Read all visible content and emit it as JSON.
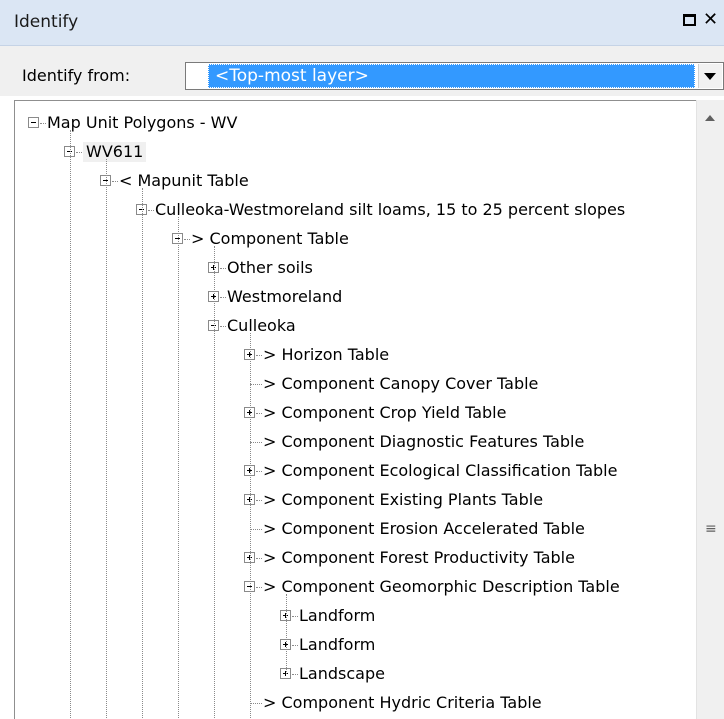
{
  "window": {
    "title": "Identify"
  },
  "identify_from": {
    "label": "Identify from:",
    "selected": "<Top-most layer>"
  },
  "tree": [
    {
      "label": "Map Unit Polygons - WV",
      "toggle": "minus",
      "level": 0
    },
    {
      "label": "WV611",
      "toggle": "minus",
      "level": 1,
      "highlight": true
    },
    {
      "label": "< Mapunit Table",
      "toggle": "minus",
      "level": 2
    },
    {
      "label": "Culleoka-Westmoreland silt loams, 15 to 25 percent slopes",
      "toggle": "minus",
      "level": 3
    },
    {
      "label": "> Component Table",
      "toggle": "minus",
      "level": 4
    },
    {
      "label": "Other soils",
      "toggle": "plus",
      "level": 5
    },
    {
      "label": "Westmoreland",
      "toggle": "plus",
      "level": 5
    },
    {
      "label": "Culleoka",
      "toggle": "minus",
      "level": 5
    },
    {
      "label": "> Horizon Table",
      "toggle": "plus",
      "level": 6
    },
    {
      "label": "> Component Canopy Cover Table",
      "toggle": "none",
      "level": 6
    },
    {
      "label": "> Component Crop Yield Table",
      "toggle": "plus",
      "level": 6
    },
    {
      "label": "> Component Diagnostic Features Table",
      "toggle": "none",
      "level": 6
    },
    {
      "label": "> Component Ecological Classification Table",
      "toggle": "plus",
      "level": 6
    },
    {
      "label": "> Component Existing Plants Table",
      "toggle": "plus",
      "level": 6
    },
    {
      "label": "> Component Erosion Accelerated Table",
      "toggle": "none",
      "level": 6
    },
    {
      "label": "> Component Forest Productivity Table",
      "toggle": "plus",
      "level": 6
    },
    {
      "label": "> Component Geomorphic Description Table",
      "toggle": "minus",
      "level": 6
    },
    {
      "label": "Landform",
      "toggle": "plus",
      "level": 7
    },
    {
      "label": "Landform",
      "toggle": "plus",
      "level": 7
    },
    {
      "label": "Landscape",
      "toggle": "plus",
      "level": 7
    },
    {
      "label": "> Component Hydric Criteria Table",
      "toggle": "none",
      "level": 6
    }
  ]
}
